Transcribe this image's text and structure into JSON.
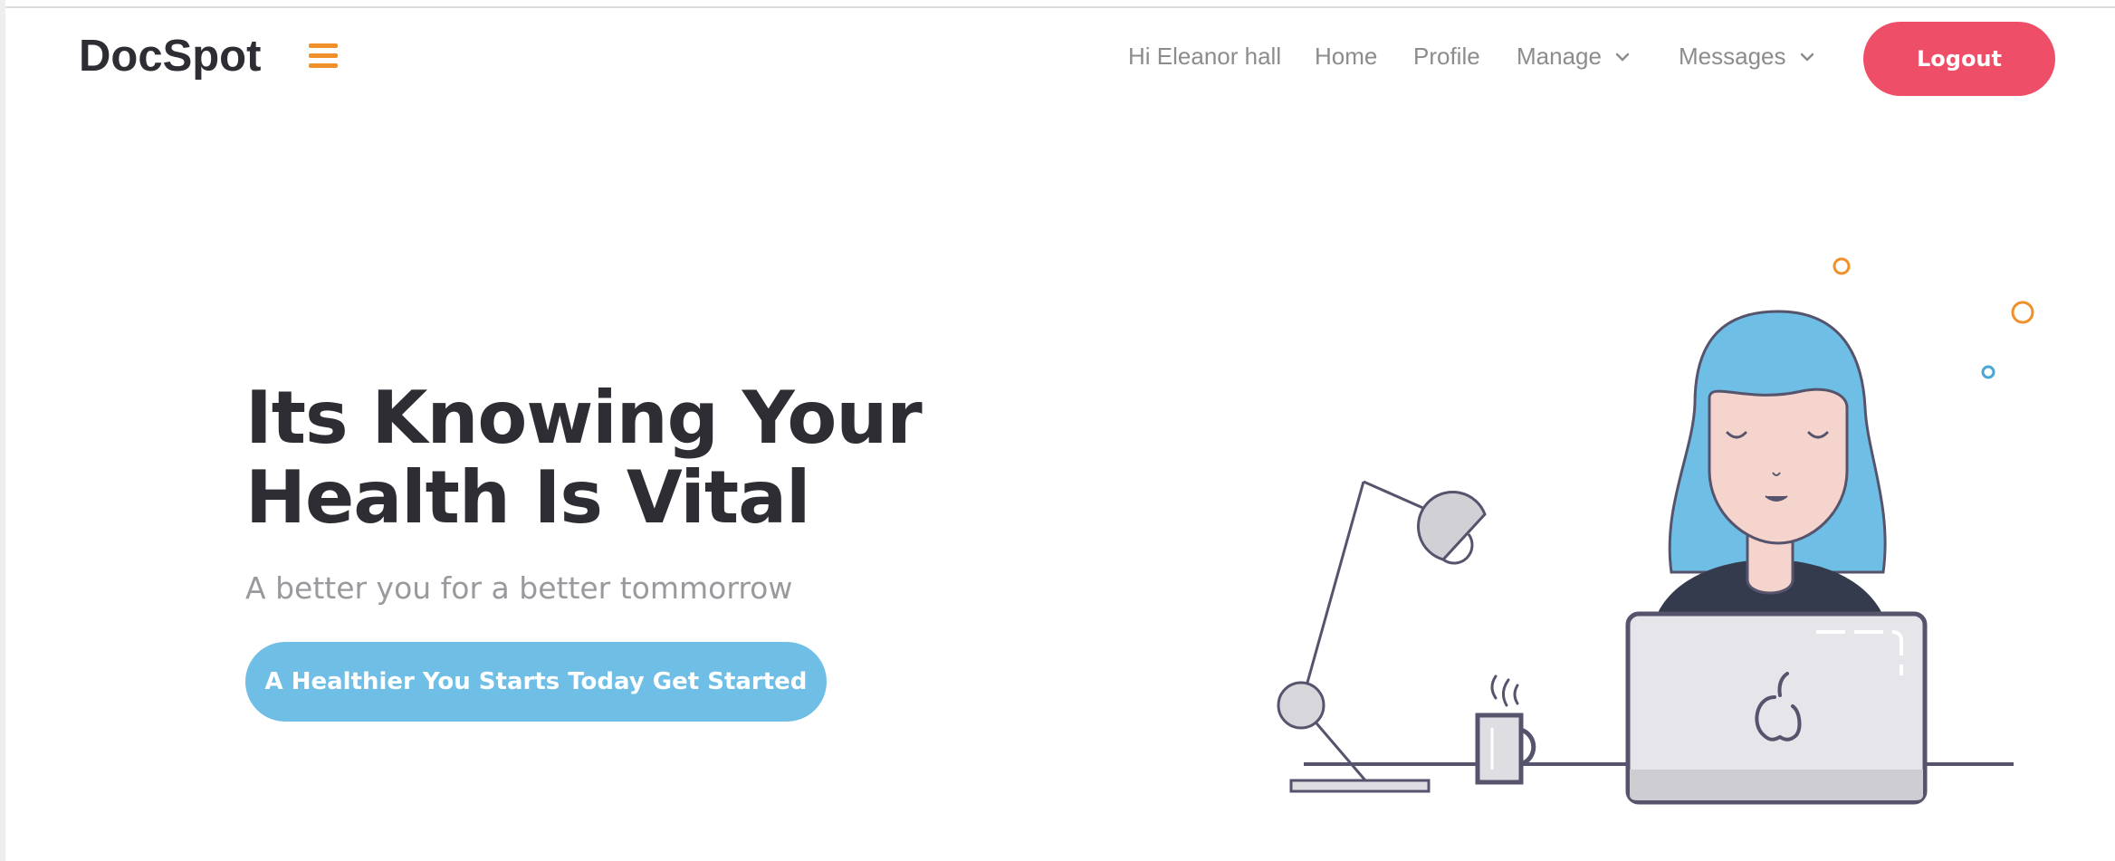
{
  "brand": {
    "name": "DocSpot"
  },
  "icons": {
    "menu": "hamburger-icon",
    "dropdown": "chevron-down-icon"
  },
  "nav": {
    "greeting": "Hi Eleanor hall",
    "home": "Home",
    "profile": "Profile",
    "manage": "Manage",
    "messages": "Messages",
    "logout": "Logout"
  },
  "hero": {
    "title_line1": "Its Knowing Your",
    "title_line2": "Health Is Vital",
    "subtitle": "A better you for a better tommorrow",
    "cta": "A Healthier You Starts Today Get Started"
  },
  "colors": {
    "accent_orange": "#f0902a",
    "logout_red": "#ee4e67",
    "cta_blue": "#6ebee5",
    "heading": "#2d2d33",
    "muted_text": "#8c8c8f"
  }
}
